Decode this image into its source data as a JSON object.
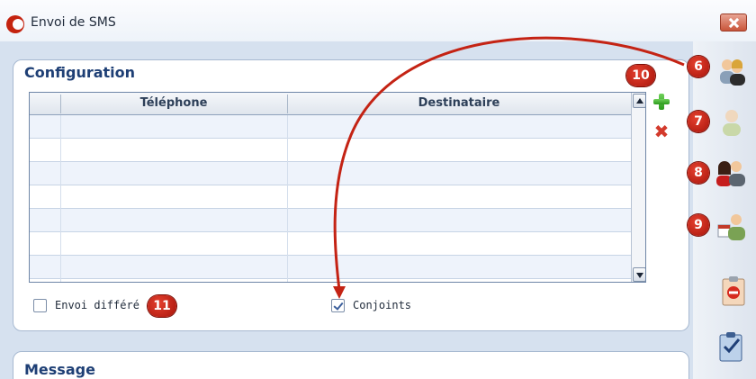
{
  "window": {
    "title": "Envoi de SMS",
    "close_label": "x"
  },
  "configuration": {
    "title": "Configuration",
    "columns": [
      "Téléphone",
      "Destinataire"
    ],
    "rows": [
      {
        "telephone": "",
        "destinataire": ""
      },
      {
        "telephone": "",
        "destinataire": ""
      },
      {
        "telephone": "",
        "destinataire": ""
      },
      {
        "telephone": "",
        "destinataire": ""
      },
      {
        "telephone": "",
        "destinataire": ""
      },
      {
        "telephone": "",
        "destinataire": ""
      },
      {
        "telephone": "",
        "destinataire": ""
      }
    ],
    "envoi_differe_label": "Envoi différé",
    "envoi_differe_checked": false,
    "conjoints_label": "Conjoints",
    "conjoints_checked": true
  },
  "message": {
    "title": "Message"
  },
  "badges": {
    "b6": "6",
    "b7": "7",
    "b8": "8",
    "b9": "9",
    "b10": "10",
    "b11": "11"
  },
  "side_icons": [
    "contacts-couple-icon",
    "single-contact-icon",
    "group-contact-icon",
    "calendar-contact-icon",
    "cancel-clipboard-icon",
    "validate-clipboard-icon"
  ],
  "colors": {
    "accent": "#1e3f75",
    "badge": "#c42314",
    "arrow": "#c42314",
    "panel_border": "#a7b9d1"
  }
}
